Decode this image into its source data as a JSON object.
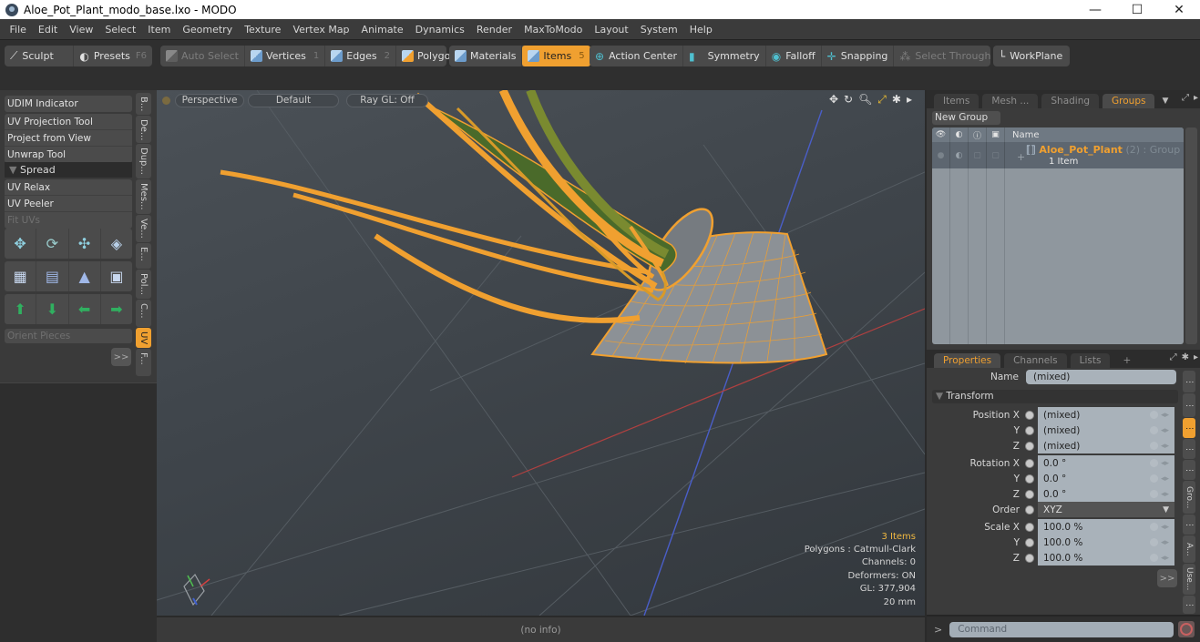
{
  "window": {
    "title": "Aloe_Pot_Plant_modo_base.lxo - MODO",
    "controls": {
      "minimize": "—",
      "maximize": "☐",
      "close": "✕"
    }
  },
  "menu": [
    "File",
    "Edit",
    "View",
    "Select",
    "Item",
    "Geometry",
    "Texture",
    "Vertex Map",
    "Animate",
    "Dynamics",
    "Render",
    "MaxToModo",
    "Layout",
    "System",
    "Help"
  ],
  "toolbar": {
    "sculpt": "Sculpt",
    "presets": "Presets",
    "presets_key": "F6",
    "auto_select": "Auto Select",
    "vertices": "Vertices",
    "vertices_key": "1",
    "edges": "Edges",
    "edges_key": "2",
    "polygons": "Polygons",
    "materials": "Materials",
    "items": "Items",
    "items_key": "5",
    "action_center": "Action Center",
    "symmetry": "Symmetry",
    "falloff": "Falloff",
    "snapping": "Snapping",
    "select_through": "Select Through",
    "workplane": "WorkPlane"
  },
  "left_panel": {
    "udim": "UDIM Indicator",
    "tools": [
      "UV Projection Tool",
      "Project from View",
      "Unwrap Tool"
    ],
    "section": "Spread",
    "relax_tools": [
      "UV Relax",
      "UV Peeler",
      "Fit UVs"
    ],
    "orient": "Orient Pieces",
    "more": ">>",
    "vtabs": [
      "B...",
      "De...",
      "Dup...",
      "Mes...",
      "Ve...",
      "E...",
      "Pol...",
      "C...",
      "UV",
      "F..."
    ],
    "active_vtab": "UV"
  },
  "viewport": {
    "view": "Perspective",
    "shading": "Default",
    "raygl": "Ray GL: Off",
    "info": {
      "items": "3 Items",
      "polygons": "Polygons : Catmull-Clark",
      "channels": "Channels: 0",
      "deformers": "Deformers: ON",
      "gl": "GL: 377,904",
      "scale": "20 mm"
    }
  },
  "status": "(no info)",
  "groups_panel": {
    "tabs": [
      "Items",
      "Mesh ...",
      "Shading",
      "Groups"
    ],
    "active_tab": "Groups",
    "new_group": "New Group",
    "name_header": "Name",
    "group": {
      "name": "Aloe_Pot_Plant",
      "count": "(2)",
      "type": ": Group",
      "items": "1 Item"
    }
  },
  "properties_panel": {
    "tabs": [
      "Properties",
      "Channels",
      "Lists",
      "+"
    ],
    "active_tab": "Properties",
    "name_label": "Name",
    "name_value": "(mixed)",
    "section": "Transform",
    "position": {
      "label": "Position X",
      "x": "(mixed)",
      "y": "(mixed)",
      "z": "(mixed)"
    },
    "rotation": {
      "label": "Rotation X",
      "x": "0.0 °",
      "y": "0.0 °",
      "z": "0.0 °"
    },
    "order": {
      "label": "Order",
      "value": "XYZ"
    },
    "scale": {
      "label": "Scale X",
      "x": "100.0 %",
      "y": "100.0 %",
      "z": "100.0 %"
    },
    "axis_y": "Y",
    "axis_z": "Z",
    "more": ">>",
    "vtabs": [
      "⋮",
      "⋮",
      "⋮",
      "⋮",
      "⋮",
      "Gro...",
      "⋮",
      "A...",
      "Use...",
      "⋮"
    ]
  },
  "command": {
    "prompt": ">",
    "placeholder": "Command"
  },
  "colors": {
    "accent": "#f0a030",
    "viewport_bg": "#3f454b",
    "wire": "#f0a030"
  }
}
